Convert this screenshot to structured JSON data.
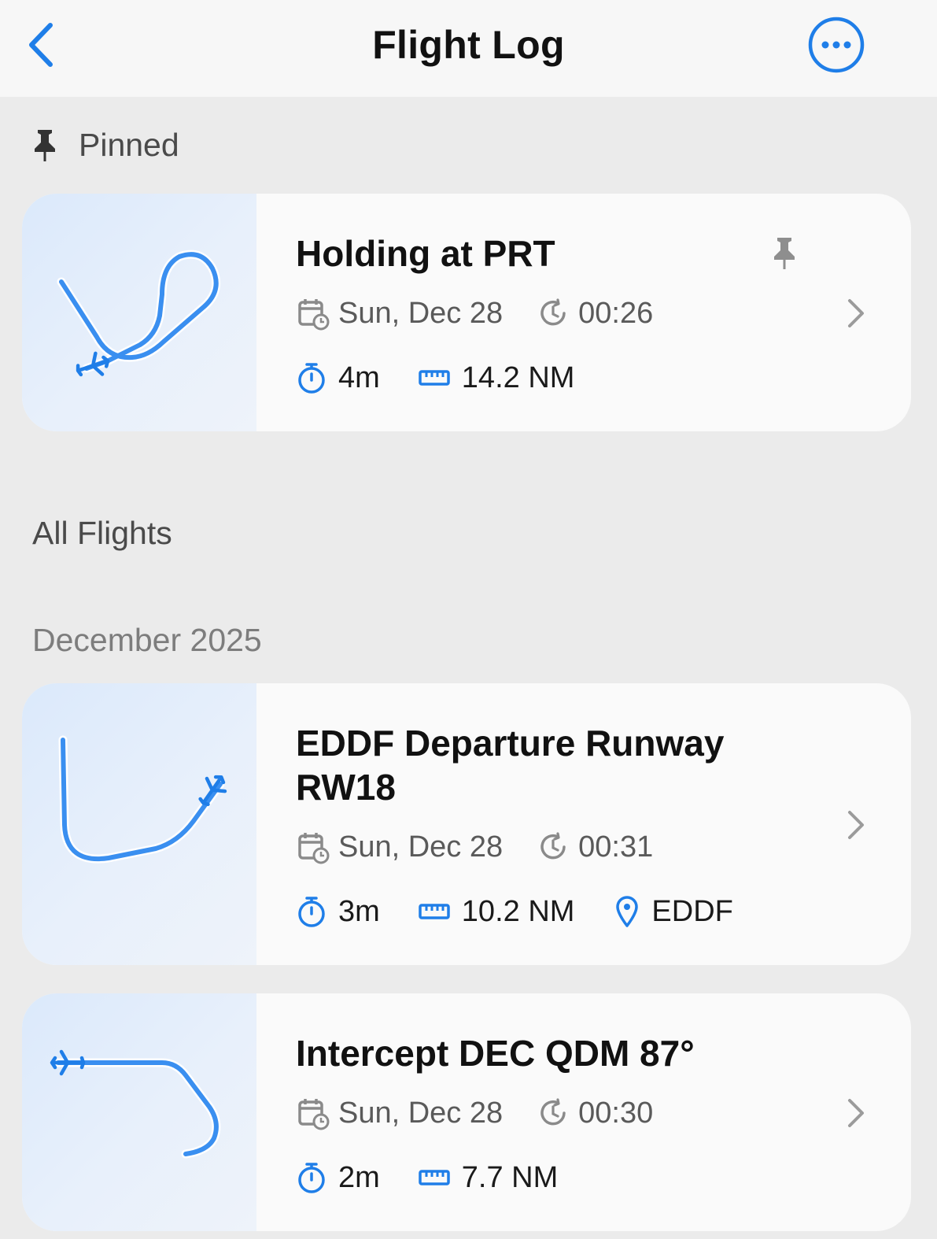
{
  "nav": {
    "title": "Flight Log"
  },
  "colors": {
    "accent": "#1f7ee8",
    "background": "#ebebeb",
    "card": "#fafafa",
    "secondary_text": "#5a5a5a"
  },
  "sections": {
    "pinned": "Pinned",
    "all_flights": "All Flights",
    "month": "December 2025"
  },
  "flights": [
    {
      "title": "Holding at PRT",
      "date": "Sun, Dec 28",
      "time": "00:26",
      "duration": "4m",
      "distance": "14.2 NM",
      "pinned": true
    },
    {
      "title": " EDDF Departure Runway RW18",
      "date": "Sun, Dec 28",
      "time": "00:31",
      "duration": "3m",
      "distance": "10.2 NM",
      "location": "EDDF",
      "pinned": false
    },
    {
      "title": "Intercept DEC QDM 87°",
      "date": "Sun, Dec 28",
      "time": "00:30",
      "duration": "2m",
      "distance": "7.7 NM",
      "pinned": false
    }
  ],
  "icons": [
    "back-chevron-icon",
    "more-ellipsis-icon",
    "pin-icon",
    "calendar-icon",
    "clock-icon",
    "stopwatch-icon",
    "ruler-icon",
    "location-pin-icon",
    "chevron-right-icon",
    "airplane-icon"
  ]
}
